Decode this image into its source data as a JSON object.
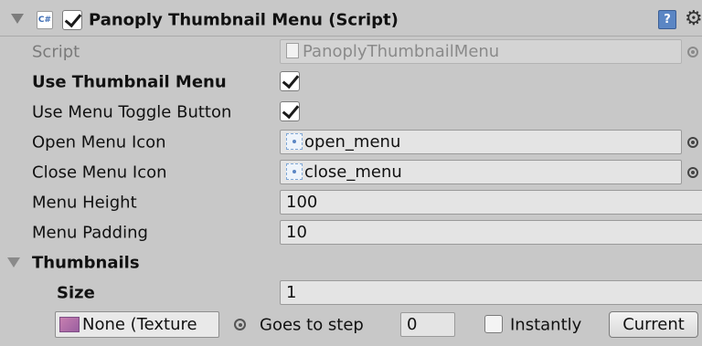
{
  "component": {
    "title": "Panoply Thumbnail Menu (Script)",
    "enabled": true,
    "cs_icon_label": "C#",
    "help_icon_label": "?"
  },
  "properties": {
    "script": {
      "label": "Script",
      "value": "PanoplyThumbnailMenu"
    },
    "use_thumbnail_menu": {
      "label": "Use Thumbnail Menu",
      "checked": true
    },
    "use_menu_toggle_button": {
      "label": "Use Menu Toggle Button",
      "checked": true
    },
    "open_menu_icon": {
      "label": "Open Menu Icon",
      "value": "open_menu"
    },
    "close_menu_icon": {
      "label": "Close Menu Icon",
      "value": "close_menu"
    },
    "menu_height": {
      "label": "Menu Height",
      "value": "100"
    },
    "menu_padding": {
      "label": "Menu Padding",
      "value": "10"
    }
  },
  "thumbnails": {
    "label": "Thumbnails",
    "size_label": "Size",
    "size_value": "1",
    "item": {
      "texture": "None (Texture",
      "goes_to_step_label": "Goes to step",
      "step_value": "0",
      "instantly_label": "Instantly",
      "instantly_checked": false,
      "current_button": "Current"
    }
  },
  "icons": [
    "foldout-arrow-icon",
    "cs-script-icon",
    "help-icon",
    "gear-icon",
    "object-picker-icon",
    "texture-icon"
  ]
}
